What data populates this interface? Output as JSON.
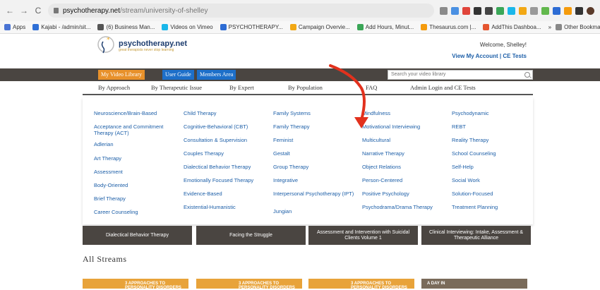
{
  "browser": {
    "url_host": "psychotherapy.net",
    "url_path": "/stream/university-of-shelley",
    "nav": {
      "back": "←",
      "forward": "→",
      "reload": "C"
    },
    "bookmarks": [
      {
        "label": "Apps",
        "color": "#4a74d4"
      },
      {
        "label": "Kajabi - /admin/sit...",
        "color": "#2f6fd6"
      },
      {
        "label": "(6) Business Man...",
        "color": "#555555"
      },
      {
        "label": "Videos on Vimeo",
        "color": "#1ab7ea"
      },
      {
        "label": "PSYCHOTHERAPY...",
        "color": "#2d6cd4"
      },
      {
        "label": "Campaign Overvie...",
        "color": "#f2a814"
      },
      {
        "label": "Add Hours, Minut...",
        "color": "#3aa657"
      },
      {
        "label": "Thesaurus.com |...",
        "color": "#f59b0c"
      },
      {
        "label": "AddThis Dashboa...",
        "color": "#e55630"
      }
    ],
    "bookmarks_more": "»",
    "other_bookmarks": "Other Bookmarks"
  },
  "site": {
    "logo_name": "psychotherapy.net",
    "logo_tagline": "great therapists never stop learning",
    "welcome": "Welcome, Shelley!",
    "my_account": "View My Account",
    "separator": "|",
    "ce_tests": "CE Tests"
  },
  "topnav": {
    "my_video_library": "My Video Library",
    "user_guide": "User Guide",
    "members_area": "Members Area",
    "search_placeholder": "Search your video library"
  },
  "approach_nav": [
    "By Approach",
    "By Therapeutic Issue",
    "By Expert",
    "By Population",
    "FAQ",
    "Admin Login and CE Tests"
  ],
  "dropdown": {
    "col1": [
      "Neuroscience/Brain-Based",
      "Acceptance and Commitment Therapy (ACT)",
      "Adlerian",
      "Art Therapy",
      "Assessment",
      "Body-Oriented",
      "Brief Therapy",
      "Career Counseling"
    ],
    "col2": [
      "Child Therapy",
      "Cognitive-Behavioral (CBT)",
      "Consultation & Supervision",
      "Couples Therapy",
      "Dialectical Behavior Therapy",
      "Emotionally Focused Therapy",
      "Evidence-Based",
      "Existential-Humanistic"
    ],
    "col3": [
      "Family Systems",
      "Family Therapy",
      "Feminist",
      "Gestalt",
      "Group Therapy",
      "Integrative",
      "Interpersonal Psychotherapy (IPT)",
      "Jungian"
    ],
    "col4": [
      "Mindfulness",
      "Motivational Interviewing",
      "Multicultural",
      "Narrative Therapy",
      "Object Relations",
      "Person-Centered",
      "Positive Psychology",
      "Psychodrama/Drama Therapy"
    ],
    "col5": [
      "Psychodynamic",
      "REBT",
      "Reality Therapy",
      "School Counseling",
      "Self-Help",
      "Social Work",
      "Solution-Focused",
      "Treatment Planning"
    ]
  },
  "tiles": [
    "Dialectical Behavior Therapy",
    "Facing the Struggle",
    "Assessment and Intervention with Suicidal Clients Volume 1",
    "Clinical Interviewing: Intake, Assessment & Therapeutic Alliance"
  ],
  "streams_title": "All Streams",
  "thumbs": [
    "3 APPROACHES TO PERSONALITY DISORDERS",
    "3 APPROACHES TO PERSONALITY DISORDERS",
    "3 APPROACHES TO PERSONALITY DISORDERS",
    "A DAY IN"
  ],
  "colors": {
    "accent_orange": "#e8912b",
    "nav_dark": "#4a4541",
    "link_blue": "#1d5fa8",
    "arrow_red": "#e2311d"
  }
}
